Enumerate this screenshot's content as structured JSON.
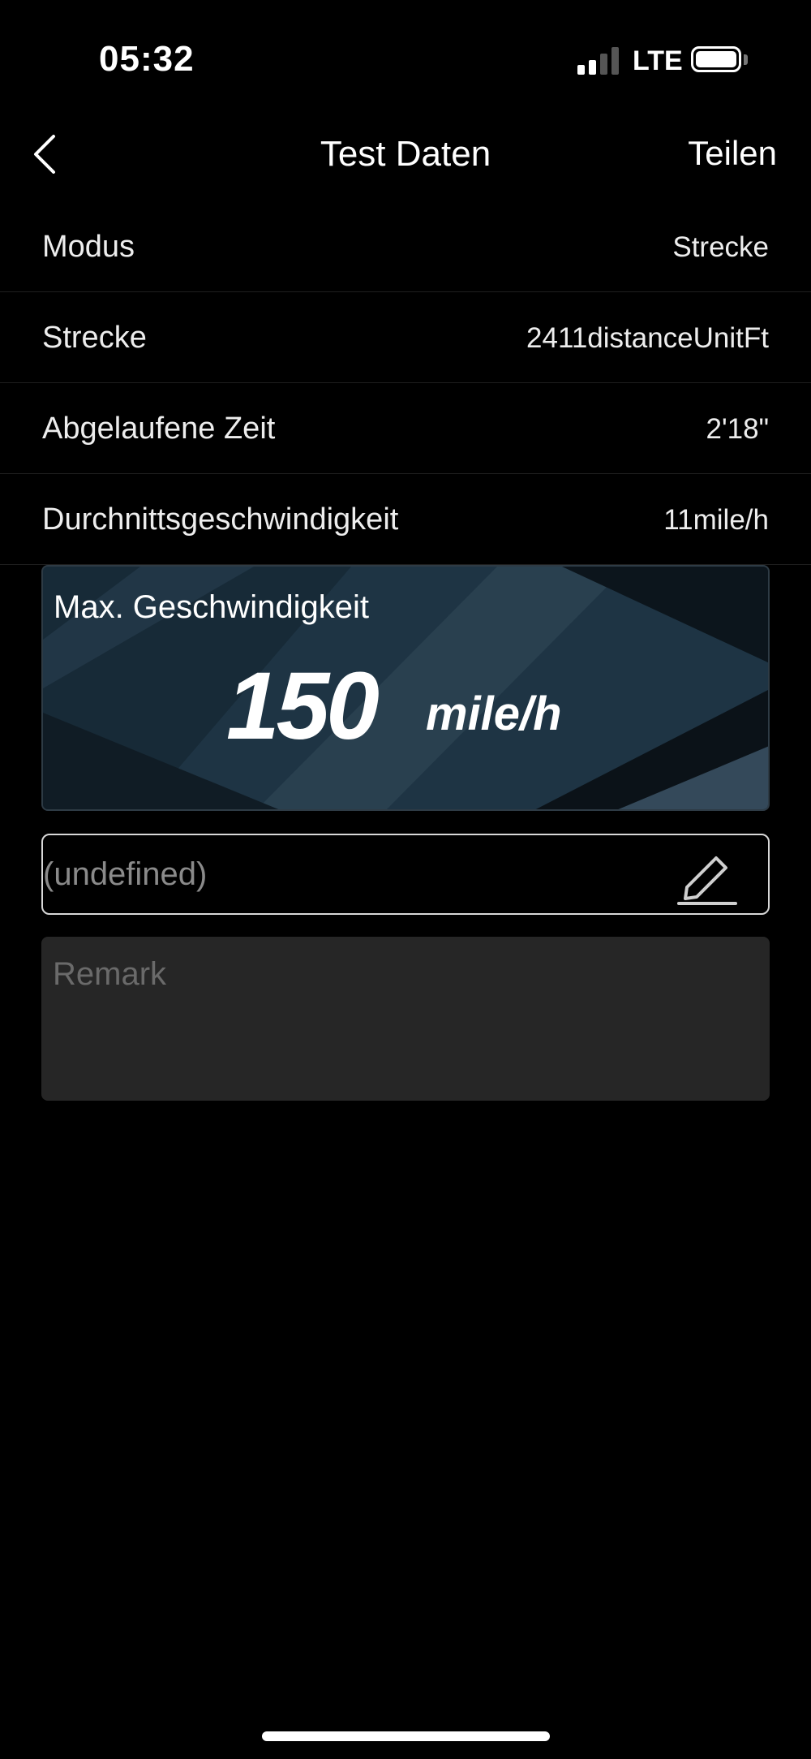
{
  "status_bar": {
    "time": "05:32",
    "network": "LTE",
    "signal_bars_active": 2,
    "signal_bars_total": 4,
    "battery_level": 0.9
  },
  "nav": {
    "title": "Test Daten",
    "share_label": "Teilen",
    "back_icon": "chevron-left-icon"
  },
  "info_rows": [
    {
      "label": "Modus",
      "value": "Strecke"
    },
    {
      "label": "Strecke",
      "value": "2411distanceUnitFt"
    },
    {
      "label": "Abgelaufene Zeit",
      "value": "2'18\""
    },
    {
      "label": "Durchnittsgeschwindigkeit",
      "value": "11mile/h"
    }
  ],
  "max_speed": {
    "label": "Max. Geschwindigkeit",
    "value": "150",
    "unit": "mile/h"
  },
  "name_field": {
    "value": "(undefined)",
    "edit_icon": "pencil-icon"
  },
  "remark": {
    "placeholder": "Remark"
  },
  "colors": {
    "background": "#000000",
    "card": "#1d3241",
    "remark_bg": "#262626"
  }
}
